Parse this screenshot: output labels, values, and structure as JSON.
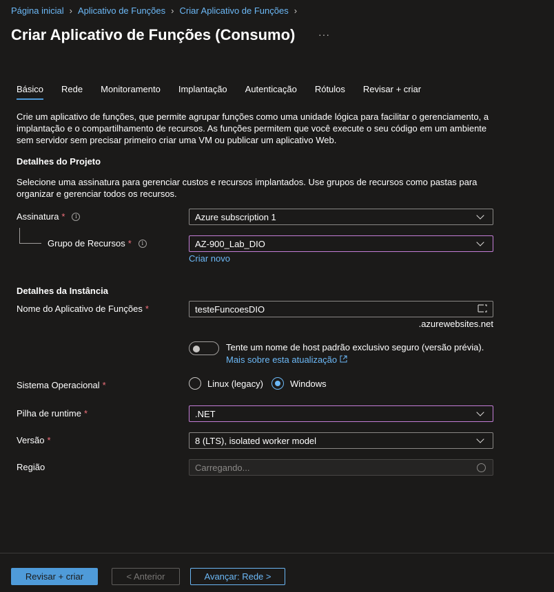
{
  "breadcrumb": [
    "Página inicial",
    "Aplicativo de Funções",
    "Criar Aplicativo de Funções"
  ],
  "page_title": "Criar Aplicativo de Funções (Consumo)",
  "more_label": "···",
  "tabs": [
    "Básico",
    "Rede",
    "Monitoramento",
    "Implantação",
    "Autenticação",
    "Rótulos",
    "Revisar + criar"
  ],
  "active_tab": "Básico",
  "intro_text": "Crie um aplicativo de funções, que permite agrupar funções como uma unidade lógica para facilitar o gerenciamento, a implantação e o compartilhamento de recursos. As funções permitem que você execute o seu código em um ambiente sem servidor sem precisar primeiro criar uma VM ou publicar um aplicativo Web.",
  "project": {
    "heading": "Detalhes do Projeto",
    "description": "Selecione uma assinatura para gerenciar custos e recursos implantados. Use grupos de recursos como pastas para organizar e gerenciar todos os recursos.",
    "subscription_label": "Assinatura",
    "subscription_value": "Azure subscription 1",
    "resource_group_label": "Grupo de Recursos",
    "resource_group_value": "AZ-900_Lab_DIO",
    "create_new": "Criar novo"
  },
  "instance": {
    "heading": "Detalhes da Instância",
    "name_label": "Nome do Aplicativo de Funções",
    "name_value": "testeFuncoesDIO",
    "name_suffix": ".azurewebsites.net",
    "hostname_toggle_text": "Tente um nome de host padrão exclusivo seguro (versão prévia).",
    "hostname_toggle_on": false,
    "hostname_link": "Mais sobre esta atualização",
    "os_label": "Sistema Operacional",
    "os_options": [
      "Linux (legacy)",
      "Windows"
    ],
    "os_selected": "Windows",
    "runtime_label": "Pilha de runtime",
    "runtime_value": ".NET",
    "version_label": "Versão",
    "version_value": "8 (LTS), isolated worker model",
    "region_label": "Região",
    "region_placeholder": "Carregando..."
  },
  "required_mark": "*",
  "info_mark": "i",
  "footer": {
    "review_create": "Revisar + criar",
    "previous": "< Anterior",
    "next": "Avançar: Rede >"
  },
  "colors": {
    "background": "#1b1a19",
    "accent": "#4f9bd9",
    "link": "#6cb8f6",
    "required": "#f1707b",
    "focus_border": "#c57ed8"
  }
}
